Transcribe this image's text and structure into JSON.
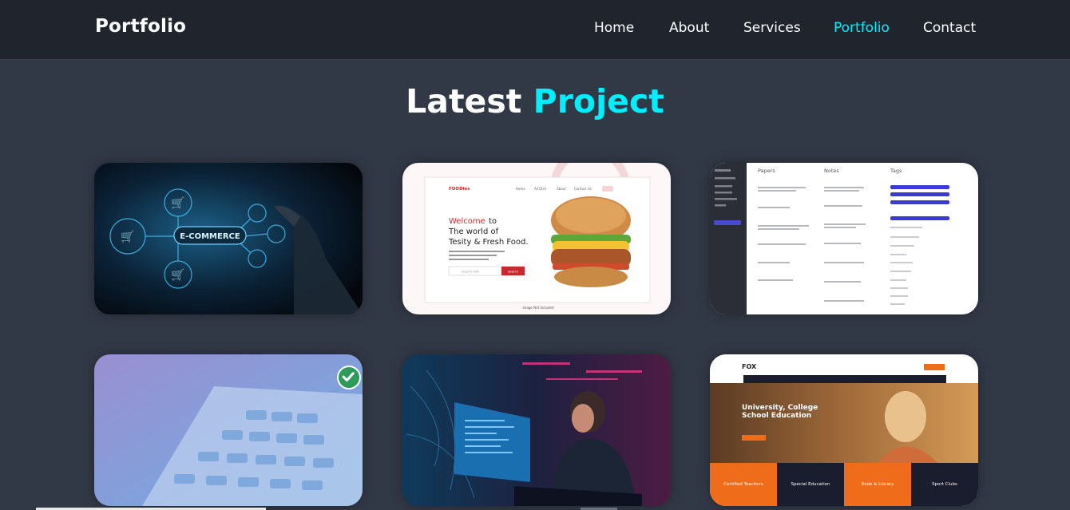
{
  "header": {
    "logo": "Portfolio",
    "nav": [
      {
        "label": "Home",
        "active": false
      },
      {
        "label": "About",
        "active": false
      },
      {
        "label": "Services",
        "active": false
      },
      {
        "label": "Portfolio",
        "active": true
      },
      {
        "label": "Contact",
        "active": false
      }
    ]
  },
  "section": {
    "title_main": "Latest",
    "title_accent": "Project"
  },
  "colors": {
    "background": "#323946",
    "header_bg": "#1f242d",
    "accent": "#00eeff"
  },
  "projects": [
    {
      "image_text": "E-COMMERCE"
    },
    {
      "brand": "FOODies",
      "nav": [
        "Home",
        "All Dish",
        "About",
        "Contact Us"
      ],
      "headline_red": "Welcome",
      "headline_rest": "to",
      "headline_line2": "The world of",
      "headline_line3": "Tesity & Fresh Food.",
      "search_placeholder": "Search dish",
      "search_button": "Search",
      "caption": "image Not Included"
    },
    {
      "columns": [
        "Papers",
        "Notes",
        "Tags"
      ]
    },
    {
      "icon": "check-circle-icon"
    },
    {
      "icon": "none"
    },
    {
      "brand": "FOX",
      "headline_line1": "University, College",
      "headline_line2": "School Education",
      "features": [
        "Certified Teachers",
        "Special Education",
        "Book & Library",
        "Sport Clubs"
      ]
    }
  ]
}
